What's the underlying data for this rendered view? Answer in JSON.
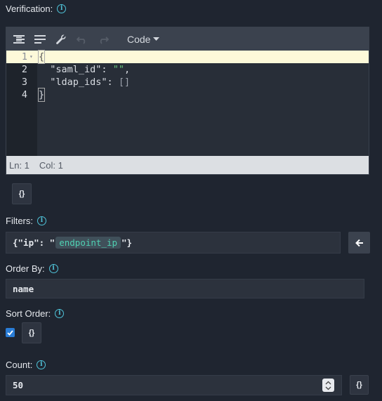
{
  "verification": {
    "label": "Verification:",
    "info_icon": "i",
    "editor": {
      "mode_label": "Code",
      "lines": [
        {
          "num": "1",
          "text": "{"
        },
        {
          "num": "2",
          "key": "\"saml_id\"",
          "colon": ": ",
          "value": "\"\"",
          "trail": ","
        },
        {
          "num": "3",
          "key": "\"ldap_ids\"",
          "colon": ": ",
          "value": "[]",
          "trail": ""
        },
        {
          "num": "4",
          "text": "}"
        }
      ],
      "status": {
        "ln": "Ln: 1",
        "col": "Col: 1"
      }
    },
    "json_button_label": "{}"
  },
  "filters": {
    "label": "Filters:",
    "info_icon": "i",
    "prefix": "{\"ip\": \"",
    "chip": "endpoint_ip",
    "suffix": "\"}"
  },
  "order_by": {
    "label": "Order By:",
    "info_icon": "i",
    "value": "name"
  },
  "sort_order": {
    "label": "Sort Order:",
    "info_icon": "i",
    "checked": true,
    "json_button_label": "{}"
  },
  "count": {
    "label": "Count:",
    "info_icon": "i",
    "value": "50",
    "json_button_label": "{}"
  },
  "colors": {
    "background": "#1f2530",
    "accent": "#4fc3d9",
    "string": "#67c47a",
    "chip_text": "#4fd1b3",
    "checkbox": "#2a7dd6"
  },
  "icons": [
    "info-icon",
    "format-icon",
    "compact-icon",
    "repair-icon",
    "undo-icon",
    "redo-icon",
    "chevron-down-icon",
    "arrow-left-icon",
    "check-icon",
    "stepper-icon"
  ]
}
